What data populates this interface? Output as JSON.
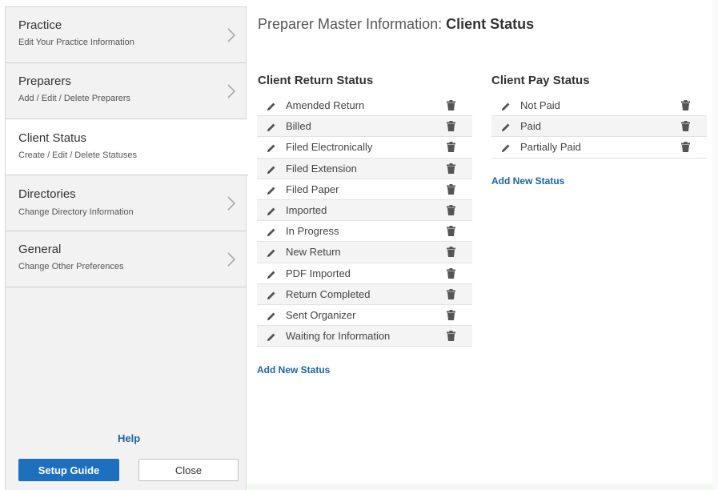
{
  "sidebar": {
    "items": [
      {
        "title": "Practice",
        "subtitle": "Edit Your Practice Information",
        "active": false
      },
      {
        "title": "Preparers",
        "subtitle": "Add / Edit / Delete Preparers",
        "active": false
      },
      {
        "title": "Client Status",
        "subtitle": "Create / Edit / Delete Statuses",
        "active": true
      },
      {
        "title": "Directories",
        "subtitle": "Change Directory Information",
        "active": false
      },
      {
        "title": "General",
        "subtitle": "Change Other Preferences",
        "active": false
      }
    ],
    "help_label": "Help",
    "setup_guide_label": "Setup Guide",
    "close_label": "Close"
  },
  "main": {
    "title_prefix": "Preparer Master Information: ",
    "title_bold": "Client Status",
    "return_status": {
      "heading": "Client Return Status",
      "items": [
        "Amended Return",
        "Billed",
        "Filed Electronically",
        "Filed Extension",
        "Filed Paper",
        "Imported",
        "In Progress",
        "New Return",
        "PDF Imported",
        "Return Completed",
        "Sent Organizer",
        "Waiting for Information"
      ],
      "add_label": "Add New Status"
    },
    "pay_status": {
      "heading": "Client Pay Status",
      "items": [
        "Not Paid",
        "Paid",
        "Partially Paid"
      ],
      "add_label": "Add New Status"
    }
  },
  "colors": {
    "accent": "#1d6fc0",
    "link": "#1b64a6",
    "sidebar_bg": "#f2f2f2",
    "row_alt": "#f4f4f4"
  },
  "icons": {
    "edit": "pencil-icon",
    "delete": "trash-icon",
    "nav": "chevron-right-icon"
  }
}
